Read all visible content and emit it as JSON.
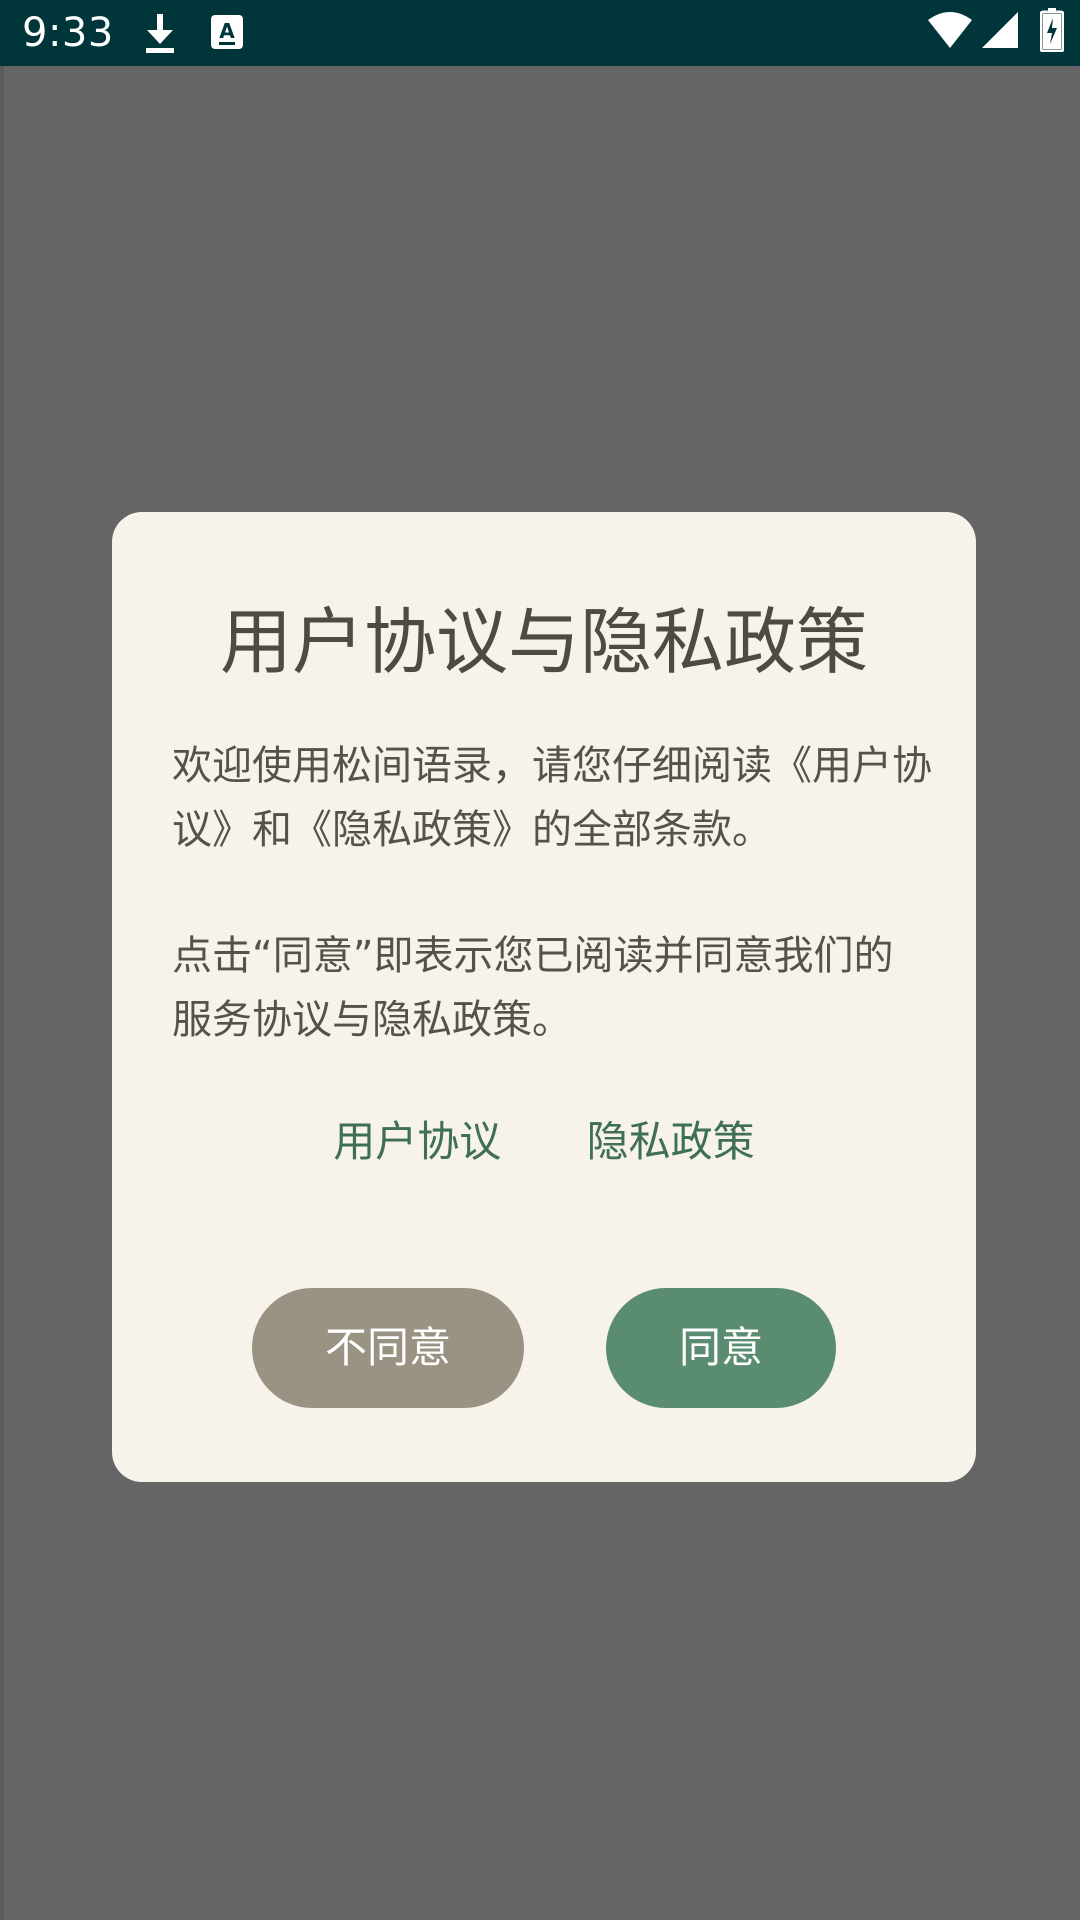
{
  "status_bar": {
    "time": "9:33",
    "icons": [
      "download-icon",
      "a-notification-icon",
      "wifi-icon",
      "signal-icon",
      "battery-charging-icon"
    ],
    "background_color": "#00363a"
  },
  "dialog": {
    "title": "用户协议与隐私政策",
    "paragraph1": "欢迎使用松间语录，请您仔细阅读《用户协议》和《隐私政策》的全部条款。",
    "paragraph2": "点击“同意”即表示您已阅读并同意我们的服务协议与隐私政策。",
    "links": {
      "user_agreement": "用户协议",
      "privacy_policy": "隐私政策"
    },
    "buttons": {
      "decline": "不同意",
      "accept": "同意"
    },
    "colors": {
      "dialog_background": "#f7f3ea",
      "link": "#3f6f54",
      "decline_button": "#9a9283",
      "accept_button": "#5a8c72",
      "scrim": "#656565"
    }
  }
}
